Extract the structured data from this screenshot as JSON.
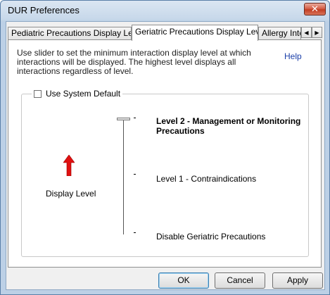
{
  "window": {
    "title": "DUR Preferences",
    "close_label": "✕"
  },
  "tabs": [
    {
      "label": "Pediatric Precautions Display Level",
      "active": false
    },
    {
      "label": "Geriatric Precautions Display Level",
      "active": true
    },
    {
      "label": "Allergy Inter",
      "active": false
    }
  ],
  "tab_scroll": {
    "left": "◀",
    "right": "▶"
  },
  "panel": {
    "instructions": "Use slider to set the minimum interaction display level at which interactions will be displayed.  The highest level displays all interactions regardless of level.",
    "help_label": "Help",
    "use_system_default_label": "Use System Default",
    "use_system_default_checked": false,
    "display_level_label": "Display Level",
    "arrow_color": "#e01010",
    "slider": {
      "levels": [
        {
          "label": "Level 2 - Management or Monitoring Precautions",
          "selected": true
        },
        {
          "label": "Level 1 - Contraindications",
          "selected": false
        },
        {
          "label": "Disable Geriatric Precautions",
          "selected": false
        }
      ],
      "selected_index": 0
    }
  },
  "buttons": {
    "ok": "OK",
    "cancel": "Cancel",
    "apply": "Apply"
  }
}
